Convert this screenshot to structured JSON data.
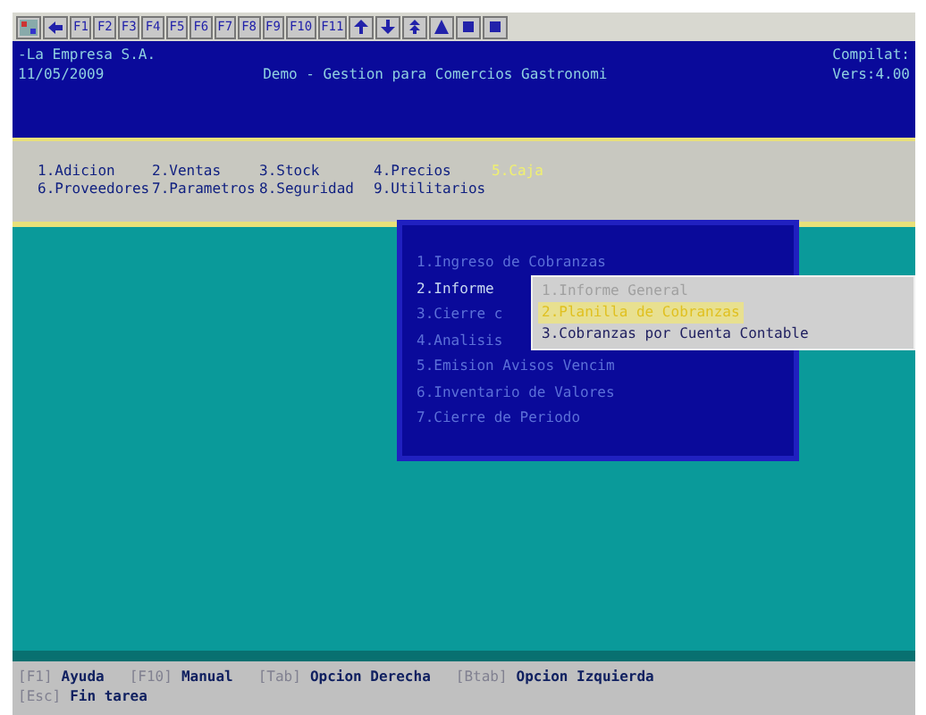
{
  "toolbar": {
    "keys": [
      "F1",
      "F2",
      "F3",
      "F4",
      "F5",
      "F6",
      "F7",
      "F8",
      "F9",
      "F10",
      "F11"
    ],
    "icons": [
      {
        "kind": "up"
      },
      {
        "kind": "down"
      },
      {
        "kind": "pgup"
      },
      {
        "kind": "top"
      },
      {
        "kind": "stop"
      },
      {
        "kind": "stop"
      }
    ]
  },
  "header": {
    "company": "-La Empresa S.A.",
    "date": "11/05/2009",
    "title": "Demo - Gestion para Comercios Gastronomi",
    "build": "Compilat:",
    "version": "Vers:4.00"
  },
  "menu": [
    {
      "label": "1.Adicion",
      "selected": false
    },
    {
      "label": "2.Ventas",
      "selected": false
    },
    {
      "label": "3.Stock",
      "selected": false
    },
    {
      "label": "4.Precios",
      "selected": false
    },
    {
      "label": "5.Caja",
      "selected": true
    },
    {
      "label": "6.Proveedores",
      "selected": false
    },
    {
      "label": "7.Parametros",
      "selected": false
    },
    {
      "label": "8.Seguridad",
      "selected": false
    },
    {
      "label": "9.Utilitarios",
      "selected": false
    }
  ],
  "popup": [
    {
      "label": "1.Ingreso de Cobranzas",
      "selected": false
    },
    {
      "label": "2.Informe",
      "selected": true
    },
    {
      "label": "3.Cierre c",
      "selected": false
    },
    {
      "label": "4.Analisis",
      "selected": false
    },
    {
      "label": "5.Emision Avisos Vencim",
      "selected": false
    },
    {
      "label": "6.Inventario de Valores",
      "selected": false
    },
    {
      "label": "7.Cierre de Periodo",
      "selected": false
    }
  ],
  "submenu": [
    {
      "label": "1.Informe General",
      "selected": false
    },
    {
      "label": "2.Planilla de Cobranzas",
      "selected": true
    },
    {
      "label": "3.Cobranzas por Cuenta Contable",
      "selected": false
    }
  ],
  "status_bar": [
    {
      "key": "[F1]",
      "label": "Ayuda"
    },
    {
      "key": "[F10]",
      "label": "Manual"
    },
    {
      "key": "[Tab]",
      "label": "Opcion Derecha"
    },
    {
      "key": "[Btab]",
      "label": "Opcion Izquierda"
    },
    {
      "key": "[Esc]",
      "label": "Fin tarea"
    }
  ]
}
